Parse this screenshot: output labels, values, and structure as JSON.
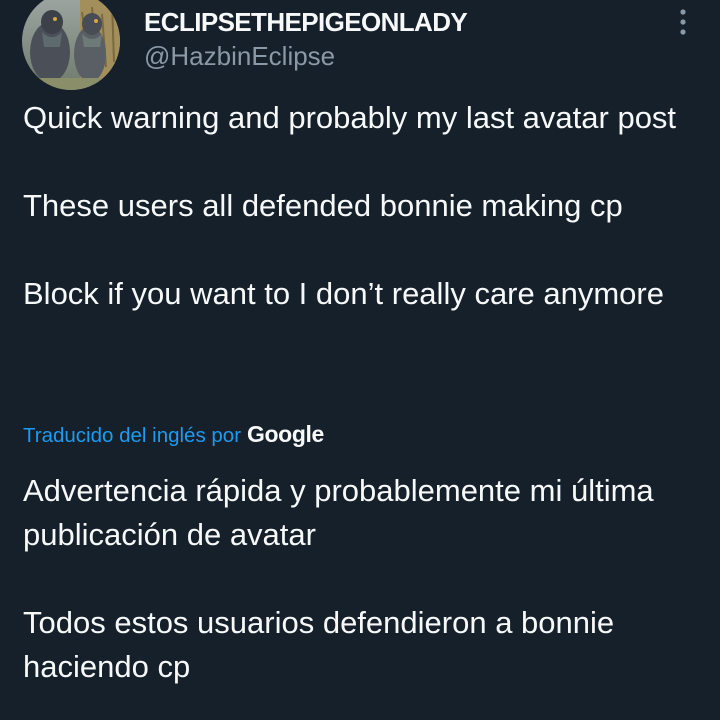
{
  "tweet": {
    "author": {
      "display_name": "ECLIPSETHEPIGEONLADY",
      "handle": "@HazbinEclipse",
      "avatar_icon": "pigeon-avatar"
    },
    "more_icon": "more-vertical-icon",
    "original_paragraphs": [
      "Quick warning and probably my last avatar post",
      "These users all defended bonnie making cp",
      "Block if you want to I don’t really care anymore"
    ],
    "translation": {
      "label": "Traducido del inglés por",
      "provider": "Google",
      "paragraphs": [
        "Advertencia rápida y probablemente mi última publicación de avatar",
        "Todos estos usuarios defendieron a bonnie haciendo cp"
      ]
    }
  },
  "colors": {
    "background": "#15202b",
    "primary_text": "#f7f9f9",
    "secondary_text": "#8b98a5",
    "link": "#1d9bf0"
  }
}
